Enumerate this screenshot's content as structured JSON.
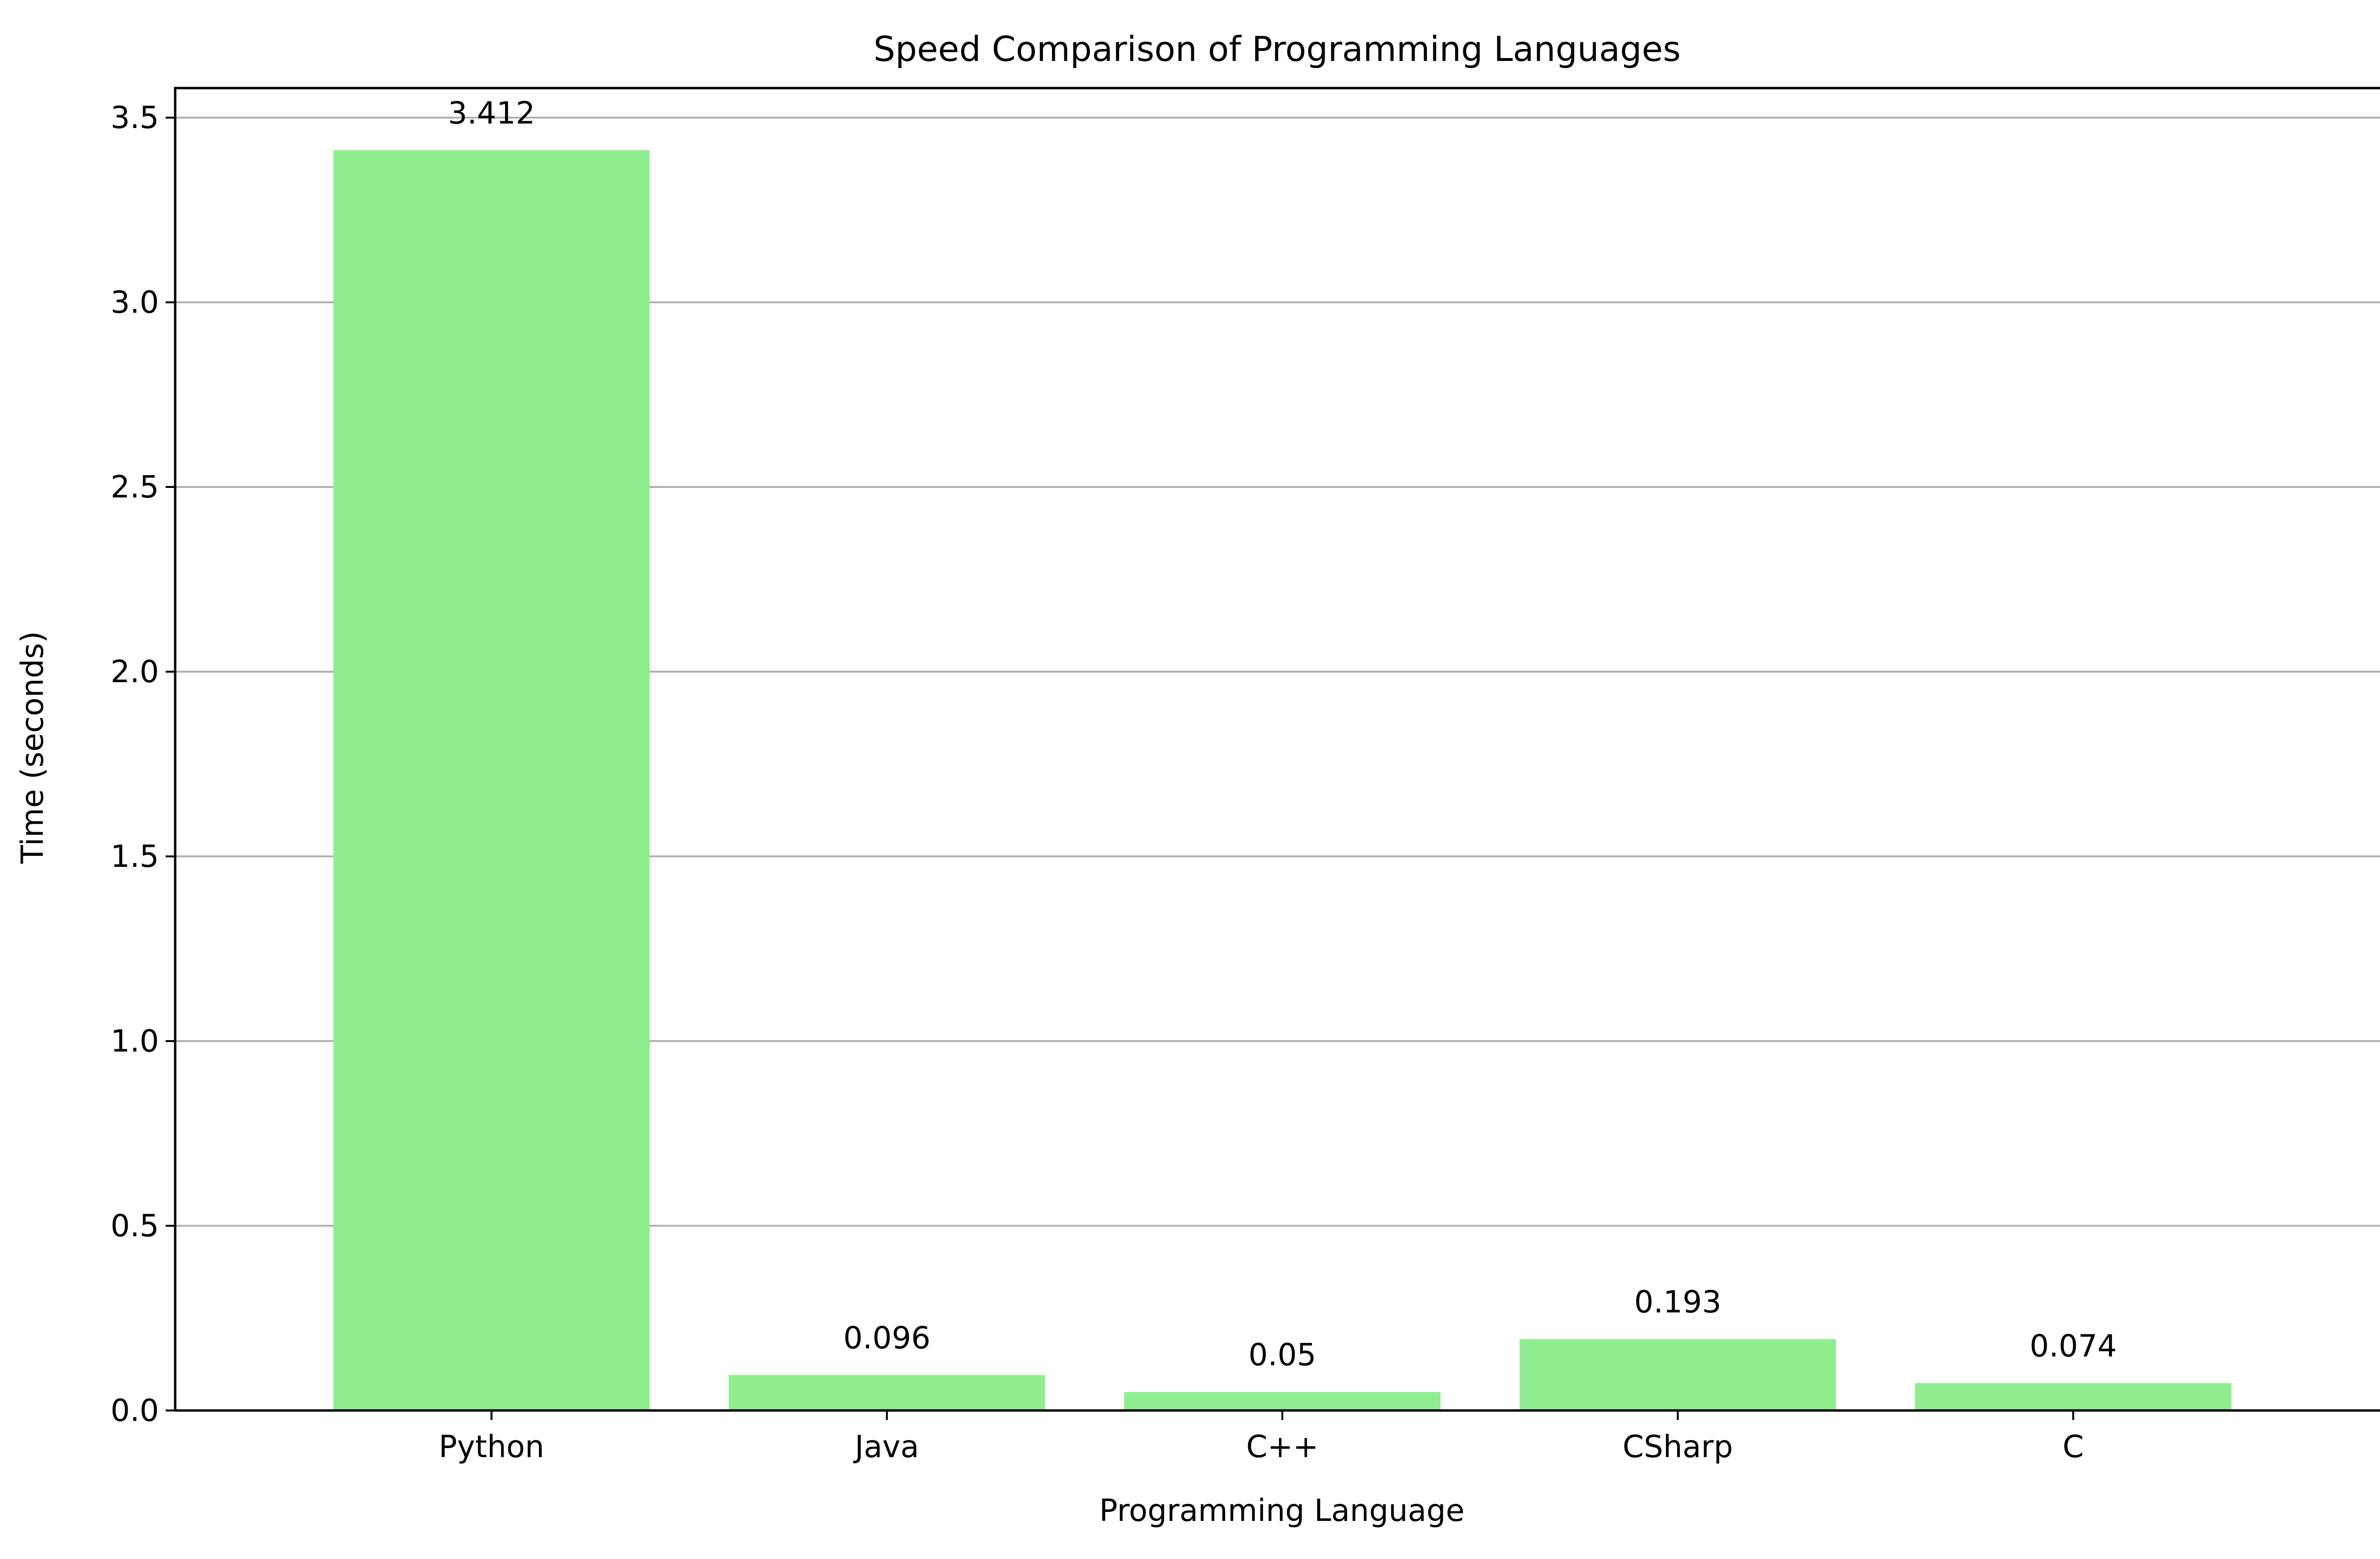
{
  "chart_data": {
    "type": "bar",
    "title": "Speed Comparison of Programming Languages",
    "xlabel": "Programming Language",
    "ylabel": "Time (seconds)",
    "categories": [
      "Python",
      "Java",
      "C++",
      "CSharp",
      "C"
    ],
    "values": [
      3.412,
      0.096,
      0.05,
      0.193,
      0.074
    ],
    "data_labels": [
      "3.412",
      "0.096",
      "0.05",
      "0.193",
      "0.074"
    ],
    "ylim": [
      0,
      3.58
    ],
    "yticks": [
      0.0,
      0.5,
      1.0,
      1.5,
      2.0,
      2.5,
      3.0,
      3.5
    ],
    "ytick_labels": [
      "0.0",
      "0.5",
      "1.0",
      "1.5",
      "2.0",
      "2.5",
      "3.0",
      "3.5"
    ],
    "grid": "y-axis major gridlines",
    "legend": "none",
    "colors": {
      "bar": "#90ee90",
      "grid": "#b0b0b0",
      "axis": "#000000",
      "text": "#000000",
      "background": "#ffffff"
    }
  }
}
